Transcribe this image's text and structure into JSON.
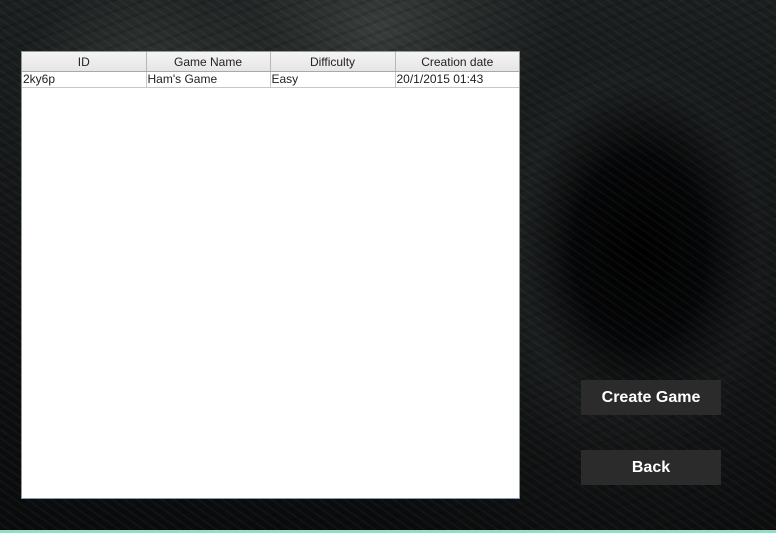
{
  "games_table": {
    "columns": [
      "ID",
      "Game Name",
      "Difficulty",
      "Creation date"
    ],
    "rows": [
      [
        "2ky6p",
        "Ham's Game",
        "Easy",
        "20/1/2015 01:43"
      ]
    ]
  },
  "buttons": {
    "create_game_label": "Create Game",
    "back_label": "Back"
  }
}
